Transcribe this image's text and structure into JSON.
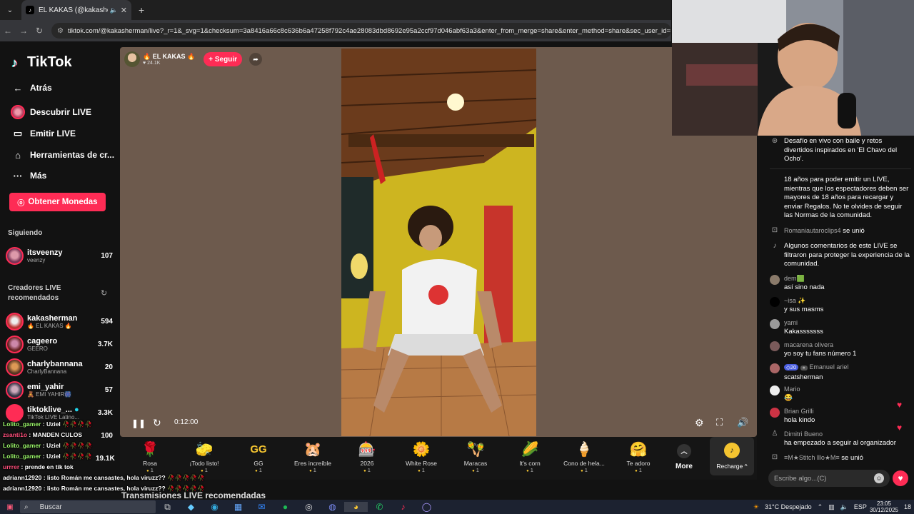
{
  "browser": {
    "tab_title": "EL KAKAS (@kakashe",
    "url": "tiktok.com/@kakasherman/live?_r=1&_svg=1&checksum=3a8416a66c8c636b6a47258f792c4ae28083dbd8692e95a2ccf97d046abf63a3&enter_from_merge=share&enter_method=share&sec_user_id=MS"
  },
  "sidebar": {
    "brand": "TikTok",
    "nav": [
      {
        "label": "Atrás"
      },
      {
        "label": "Descubrir LIVE"
      },
      {
        "label": "Emitir LIVE"
      },
      {
        "label": "Herramientas de cr..."
      },
      {
        "label": "Más"
      }
    ],
    "coins_button": "Obtener Monedas",
    "following_title": "Siguiendo",
    "following": [
      {
        "name": "itsveenzy",
        "sub": "veenzy",
        "count": "107"
      }
    ],
    "recommended_title": "Creadores LIVE recomendados",
    "recommended": [
      {
        "name": "kakasherman",
        "sub": "🔥 EL KAKAS 🔥",
        "count": "594"
      },
      {
        "name": "cageero",
        "sub": "GEERO",
        "count": "3.7K"
      },
      {
        "name": "charlybannana",
        "sub": "CharlyBannana",
        "count": "20"
      },
      {
        "name": "emi_yahir",
        "sub": "🧸 EMI YAHIR🎆",
        "count": "57"
      },
      {
        "name": "tiktoklive_...",
        "sub": "TikTok LIVE Latino...",
        "count": "3.3K"
      },
      {
        "name": "",
        "sub": "",
        "count": "100"
      },
      {
        "name": "",
        "sub": "",
        "count": "19.1K"
      }
    ]
  },
  "stream": {
    "host_name": "🔥 EL KAKAS 🔥",
    "host_views": "24.1K",
    "follow_label": "+ Seguir",
    "elapsed": "0:12:00"
  },
  "gifts": [
    {
      "label": "Rosa",
      "price": "1",
      "icon": "🌹"
    },
    {
      "label": "¡Todo listo!",
      "price": "1",
      "icon": "🧽"
    },
    {
      "label": "GG",
      "price": "1",
      "icon": "GG"
    },
    {
      "label": "Eres increíble",
      "price": "1",
      "icon": "🐹"
    },
    {
      "label": "2026",
      "price": "1",
      "icon": "🎰"
    },
    {
      "label": "White Rose",
      "price": "1",
      "icon": "🌼"
    },
    {
      "label": "Maracas",
      "price": "1",
      "icon": "🪇"
    },
    {
      "label": "It's corn",
      "price": "1",
      "icon": "🌽"
    },
    {
      "label": "Cono de hela...",
      "price": "1",
      "icon": "🍦"
    },
    {
      "label": "Te adoro",
      "price": "1",
      "icon": "🤗"
    }
  ],
  "more_label": "More",
  "recharge_label": "Recharge",
  "section_title": "Transmisiones LIVE recomendadas",
  "overlay_chat": [
    {
      "user": "Lolito_gamer",
      "msg": ": Uziel 🥀🥀🥀🥀"
    },
    {
      "user": "zsanti1o",
      "msg": ": MANDEN CULOS"
    },
    {
      "user": "Lolito_gamer",
      "msg": ": Uziel 🥀🥀🥀🥀"
    },
    {
      "user": "Lolito_gamer",
      "msg": ": Uziel 🥀🥀🥀🥀"
    },
    {
      "user": "urrrer",
      "msg": ": prende en tik tok"
    },
    {
      "user": "adriann12920",
      "msg": ": listo Román me cansastes, hola viruzz?? 🥀🥀🥀🥀🥀"
    },
    {
      "user": "adriann12920",
      "msg": ": listo Román me cansastes, hola viruzz?? 🥀🥀🥀🥀🥀"
    }
  ],
  "chat": {
    "pinned": "Desafío en vivo con baile y retos divertidos inspirados en 'El Chavo del Ocho'.",
    "notice": "18 años para poder emitir un LIVE, mientras que los espectadores deben ser mayores de 18 años para recargar y enviar Regalos. No te olvides de seguir las Normas de la comunidad.",
    "join1_user": "Romaniautaroclips4",
    "joined_label": "se unió",
    "filter_notice": "Algunos comentarios de este LIVE se filtraron para proteger la experiencia de la comunidad.",
    "messages": [
      {
        "user": "dem🟩",
        "msg": "así sino nada"
      },
      {
        "user": "~isa ✨",
        "msg": "y sus masms"
      },
      {
        "user": "yami",
        "msg": "Kakasssssss"
      },
      {
        "user": "macarena olivera",
        "msg": "yo soy tu fans número 1"
      },
      {
        "user": "Emanuel ariel",
        "badge": "20",
        "msg": "scatsherman"
      },
      {
        "user": "Mario",
        "msg": "😂"
      },
      {
        "user": "Brian Grilli",
        "msg": "hola kindo"
      },
      {
        "user": "Dimitri Bueno",
        "msg": "ha empezado a seguir al organizador"
      }
    ],
    "join2_user": "≡M★Stitch lllo★M≡",
    "input_placeholder": "Escribe algo...(C)"
  },
  "taskbar": {
    "search_label": "Buscar",
    "weather": "31°C  Despejado",
    "lang": "ESP",
    "time": "23:05",
    "date": "30/12/2025",
    "badge": "18"
  },
  "colors": {
    "accent": "#fe2c55",
    "background": "#121212",
    "stage": "#6d5a4d"
  }
}
